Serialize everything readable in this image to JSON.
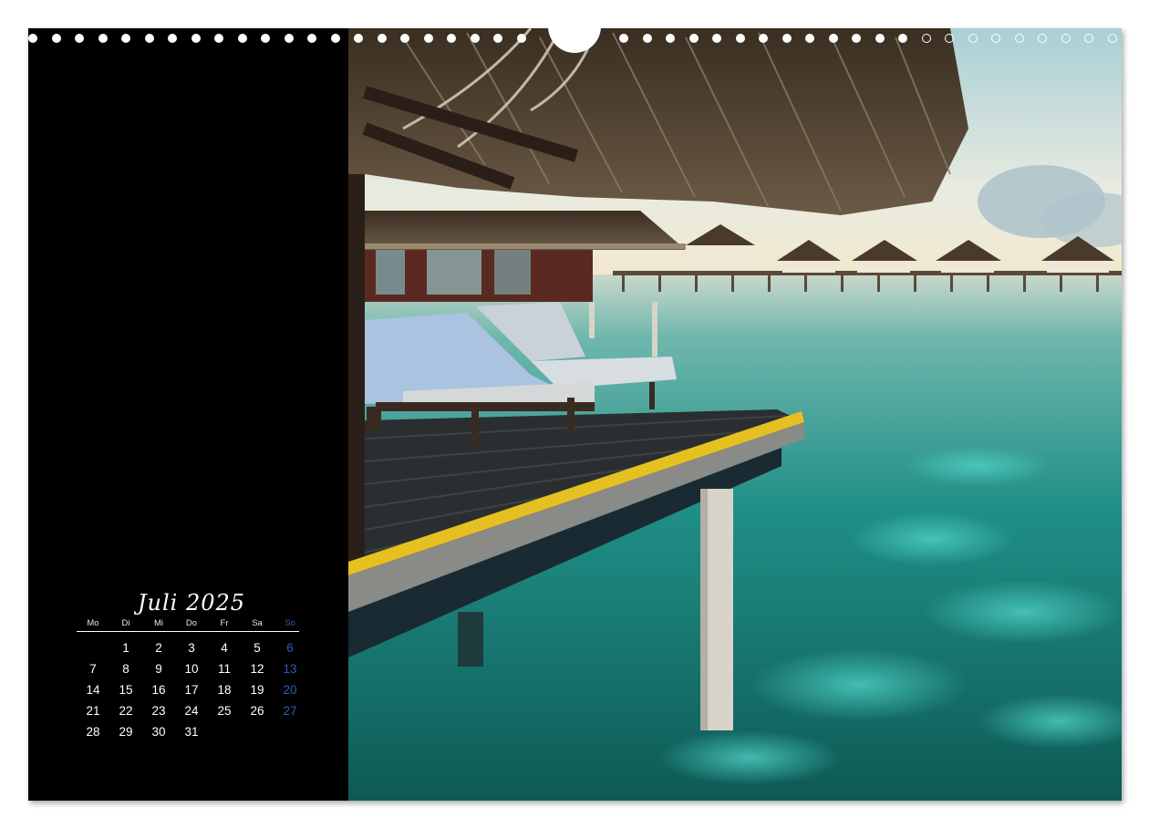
{
  "calendar": {
    "month_title": "Juli 2025",
    "weekdays": [
      "Mo",
      "Di",
      "Mi",
      "Do",
      "Fr",
      "Sa",
      "So"
    ],
    "weeks": [
      [
        "",
        "1",
        "2",
        "3",
        "4",
        "5",
        "6"
      ],
      [
        "7",
        "8",
        "9",
        "10",
        "11",
        "12",
        "13"
      ],
      [
        "14",
        "15",
        "16",
        "17",
        "18",
        "19",
        "20"
      ],
      [
        "21",
        "22",
        "23",
        "24",
        "25",
        "26",
        "27"
      ],
      [
        "28",
        "29",
        "30",
        "31",
        "",
        "",
        ""
      ]
    ],
    "sunday_color": "#2f5db8",
    "text_color": "#ffffff"
  },
  "photo": {
    "subject": "overwater-bungalow-icon"
  },
  "colors": {
    "panel_background": "#000000",
    "water": "#1f8f86",
    "deck_trim": "#e6c020"
  }
}
